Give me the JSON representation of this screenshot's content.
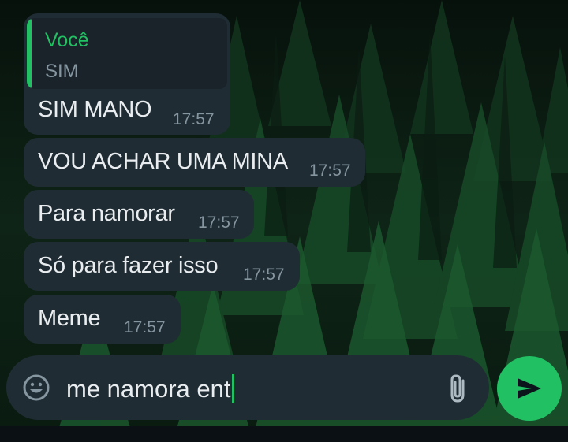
{
  "conversation": {
    "reply_message": {
      "quote_author": "Você",
      "quote_text": "SIM",
      "text": "SIM MANO",
      "time": "17:57"
    },
    "messages": [
      {
        "text": "VOU ACHAR UMA MINA",
        "time": "17:57"
      },
      {
        "text": "Para namorar",
        "time": "17:57"
      },
      {
        "text": "Só para fazer isso",
        "time": "17:57"
      },
      {
        "text": "Meme",
        "time": "17:57"
      }
    ]
  },
  "composer": {
    "value": "me namora ent",
    "emoji_icon": "emoji-icon",
    "attach_icon": "paperclip-icon"
  },
  "send": {
    "icon": "send-icon"
  },
  "colors": {
    "accent": "#21c063",
    "bubble": "#1f2c34",
    "text": "#e9edef",
    "meta": "#8696a0"
  }
}
